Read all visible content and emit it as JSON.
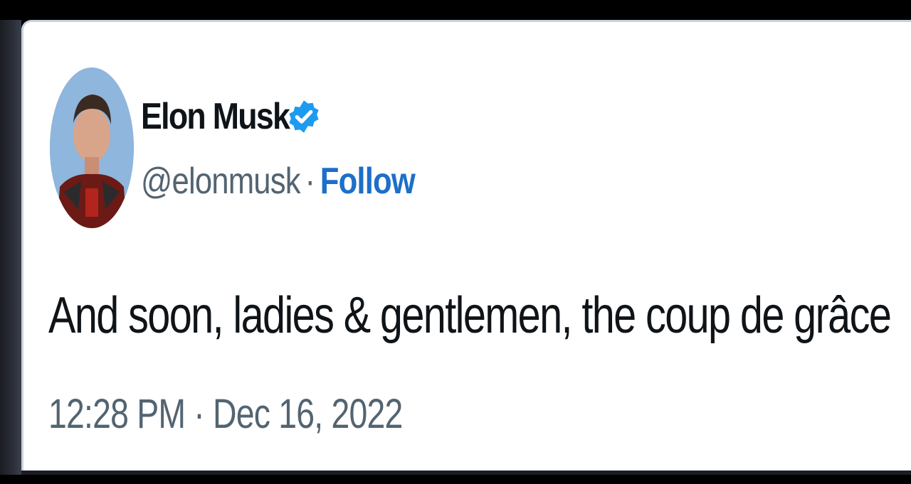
{
  "tweet": {
    "author": {
      "display_name": "Elon Musk",
      "handle": "@elonmusk",
      "separator": "·",
      "follow_label": "Follow",
      "verified": true
    },
    "text": "And soon, ladies & gentlemen, the coup de grâce",
    "timestamp": "12:28 PM · Dec 16, 2022"
  },
  "icons": {
    "verified": "verified-badge-icon",
    "avatar": "profile-photo"
  },
  "colors": {
    "background": "#000000",
    "card": "#ffffff",
    "text_primary": "#0f1419",
    "text_secondary": "#536471",
    "link": "#1d6fc9",
    "verified_badge": "#1d9bf0"
  }
}
